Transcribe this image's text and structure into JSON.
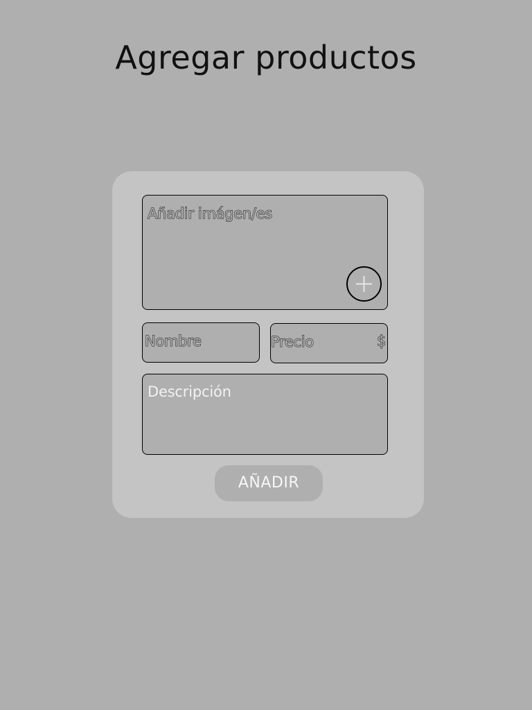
{
  "page": {
    "title": "Agregar productos"
  },
  "form": {
    "image_field": {
      "label": "Añadir imágen/es",
      "add_button_icon": "plus-icon"
    },
    "name_field": {
      "placeholder": "Nombre"
    },
    "price_field": {
      "placeholder": "Precio",
      "currency_symbol": "$"
    },
    "description_field": {
      "placeholder": "Descripción"
    },
    "submit_label": "AÑADIR"
  },
  "colors": {
    "background": "#afafaf",
    "card": "#c4c4c4",
    "field_border": "#000000"
  }
}
